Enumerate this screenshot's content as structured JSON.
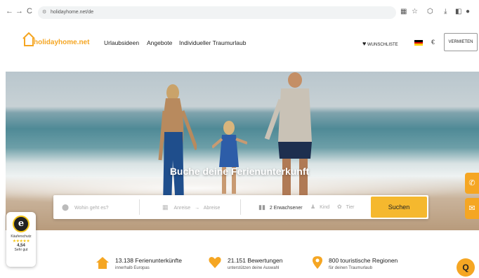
{
  "browser": {
    "back": "←",
    "forward": "→",
    "reload": "C",
    "url": "holidayhome.net/de"
  },
  "header": {
    "logo_text": "holidayhome.net",
    "menu": [
      "Urlaubsideen",
      "Angebote",
      "Individueller Traumurlaub"
    ],
    "wishlist": "WUNSCHLISTE",
    "currency": "€",
    "vermieten": "VERMIETEN"
  },
  "hero": {
    "title": "Buche deine Ferienunterkunft"
  },
  "search": {
    "where_placeholder": "Wohin geht es?",
    "arrival": "Anreise",
    "departure": "Abreise",
    "adults": "2 Erwachsener",
    "kind": "Kind",
    "tier": "Tier",
    "button": "Suchen"
  },
  "badge": {
    "letter": "e",
    "label": "Käuferschutz",
    "stars": "★★★★★",
    "score": "4,54",
    "rating": "Sehr gut"
  },
  "stats": [
    {
      "main": "13.138 Ferienunterkünfte",
      "sub": "innerhalb Europas"
    },
    {
      "main": "21.151 Bewertungen",
      "sub": "unterstützen deine Auswahl"
    },
    {
      "main": "800 touristische Regionen",
      "sub": "für deinen Traumurlaub"
    }
  ],
  "colors": {
    "accent": "#f5a623",
    "search_button": "#f5b82e"
  }
}
